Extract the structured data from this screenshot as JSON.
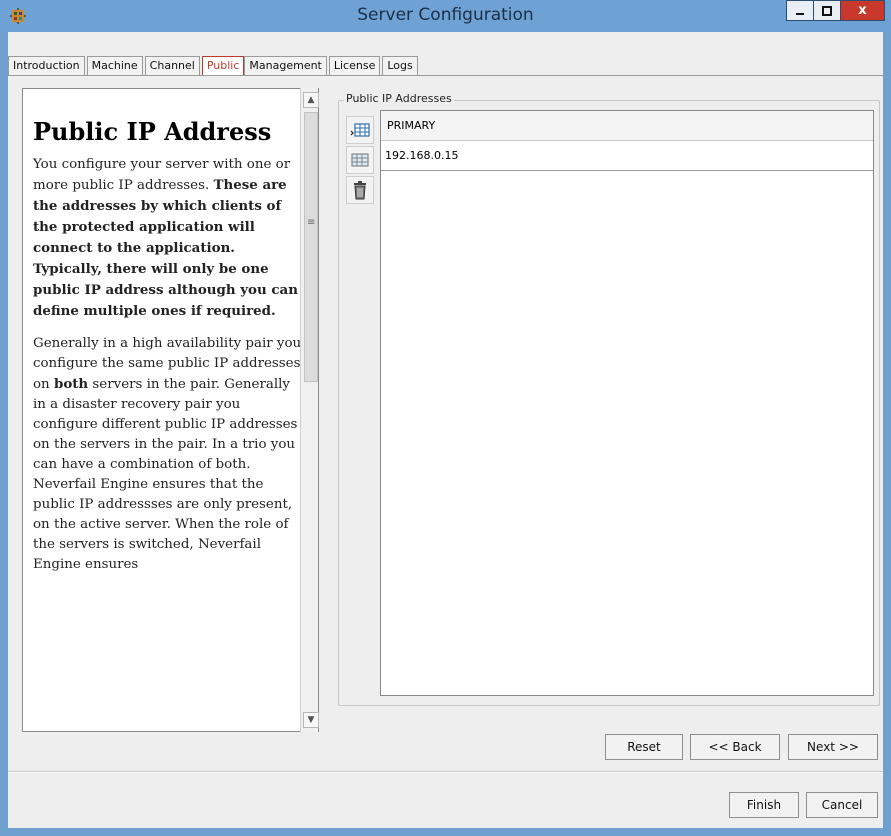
{
  "window": {
    "title": "Server Configuration",
    "close_label": "x"
  },
  "tabs": [
    {
      "label": "Introduction"
    },
    {
      "label": "Machine"
    },
    {
      "label": "Channel"
    },
    {
      "label": "Public"
    },
    {
      "label": "Management"
    },
    {
      "label": "License"
    },
    {
      "label": "Logs"
    }
  ],
  "help": {
    "title": "Public IP Address",
    "p1_normal": "You configure your server with one or more public IP addresses. ",
    "p1_bold": "These are the addresses by which clients of the protected application will connect to the application. Typically, there will only be one public IP address although you can define multiple ones if required.",
    "p2_a": "Generally in a high availability pair you configure the same public IP addresses on ",
    "p2_bold": "both",
    "p2_b": " servers in the pair. Generally in a disaster recovery pair you configure different public IP addresses on the servers in the pair. In a trio you can have a combination of both. Neverfail Engine ensures that the public IP addressses are only present, on the active server. When the role of the servers is switched, Neverfail Engine ensures"
  },
  "public_ips": {
    "group_label": "Public IP Addresses",
    "header": "PRIMARY",
    "rows": [
      "192.168.0.15"
    ]
  },
  "buttons": {
    "reset": "Reset",
    "back": "<< Back",
    "next": "Next >>",
    "finish": "Finish",
    "cancel": "Cancel"
  }
}
